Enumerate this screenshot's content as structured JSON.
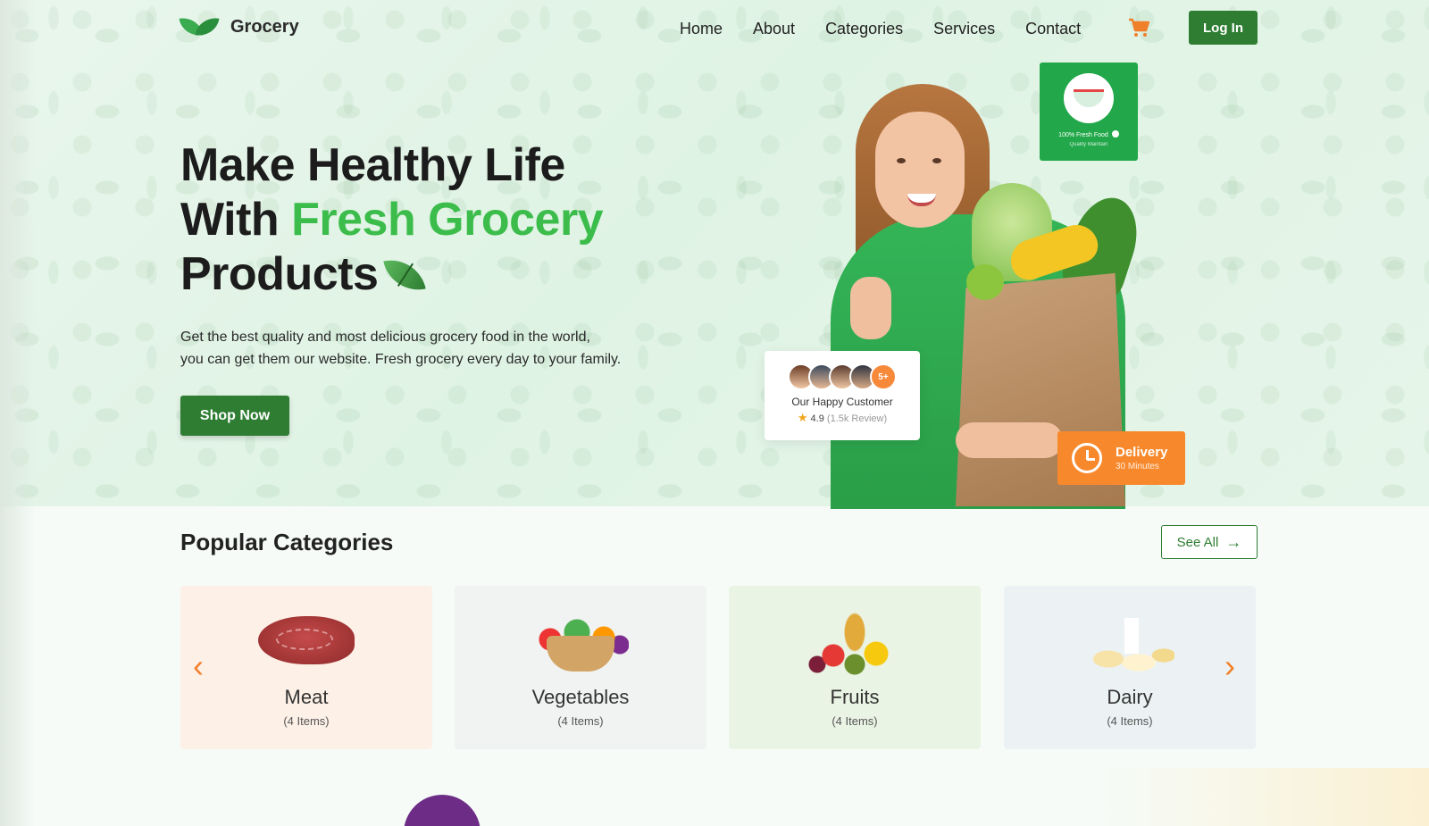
{
  "brand": {
    "name": "Grocery",
    "accent": "#2e7d32",
    "highlight": "#3cbd4b",
    "orange": "#f7892c"
  },
  "nav": {
    "links": [
      "Home",
      "About",
      "Categories",
      "Services",
      "Contact"
    ],
    "cart_icon": "cart-icon",
    "login_label": "Log In"
  },
  "hero": {
    "title_line1": "Make Healthy Life",
    "title_line2_prefix": "With ",
    "title_highlight": "Fresh Grocery",
    "title_line3": "Products",
    "description_line1": "Get the best quality and most delicious grocery food in the world,",
    "description_line2": "you can get them our website. Fresh grocery every day to your family.",
    "cta_label": "Shop Now",
    "fresh_card": {
      "title": "100% Fresh Food",
      "subtitle": "Quality Maintain"
    },
    "customer_card": {
      "more_badge": "5+",
      "label": "Our Happy Customer",
      "rating": "4.9",
      "reviews": "(1.5k Review)"
    },
    "delivery_card": {
      "title": "Delivery",
      "subtitle": "30 Minutes"
    }
  },
  "categories": {
    "heading": "Popular Categories",
    "see_all_label": "See All",
    "items": [
      {
        "name": "Meat",
        "count": "(4 Items)",
        "bg": "#fdf0e7"
      },
      {
        "name": "Vegetables",
        "count": "(4 Items)",
        "bg": "#f1f3f2"
      },
      {
        "name": "Fruits",
        "count": "(4 Items)",
        "bg": "#eaf4e4"
      },
      {
        "name": "Dairy",
        "count": "(4 Items)",
        "bg": "#ecf2f3"
      }
    ],
    "prev_icon": "chevron-left-icon",
    "next_icon": "chevron-right-icon"
  }
}
